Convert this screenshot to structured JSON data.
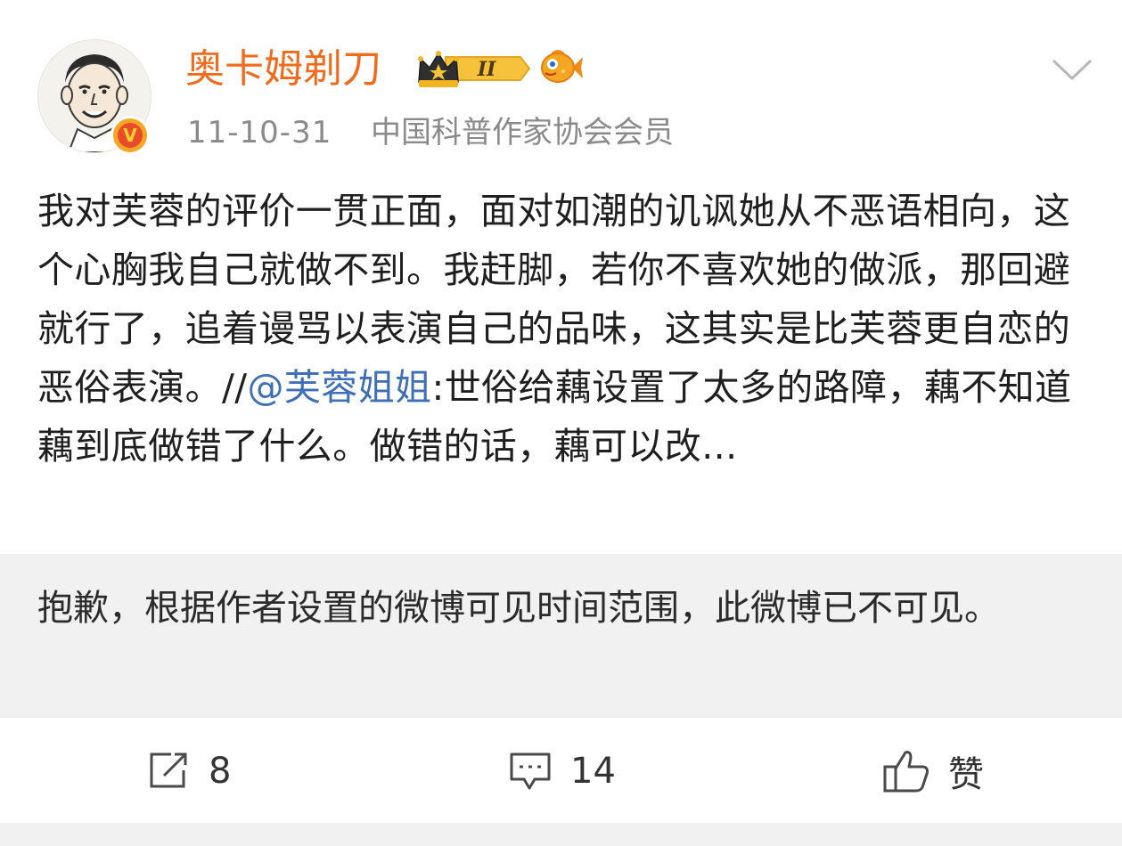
{
  "post": {
    "username": "奥卡姆剃刀",
    "time": "11-10-31",
    "user_description": "中国科普作家协会会员",
    "badges": {
      "crown_badge_text": "II",
      "verified_mark": "V"
    },
    "content_before_mention": "我对芙蓉的评价一贯正面，面对如潮的讥讽她从不恶语相向，这个心胸我自己就做不到。我赶脚，若你不喜欢她的做派，那回避就行了，追着谩骂以表演自己的品味，这其实是比芙蓉更自恋的恶俗表演。//",
    "mention": "@芙蓉姐姐",
    "content_after_mention": ":世俗给藕设置了太多的路障，藕不知道藕到底做错了什么。做错的话，藕可以改...",
    "retweet_unavailable_text": "抱歉，根据作者设置的微博可见时间范围，此微博已不可见。"
  },
  "actions": {
    "repost_count": "8",
    "comment_count": "14",
    "like_label": "赞"
  },
  "icons": {
    "more": "chevron-down-icon",
    "repost": "share-icon",
    "comment": "comment-icon",
    "like": "thumbs-up-icon",
    "verified": "verified-v-icon",
    "crown": "crown-badge-icon",
    "fish": "fish-badge-icon"
  },
  "colors": {
    "username": "#f26b1d",
    "mention": "#3f6fb6",
    "meta_text": "#8a8a8a",
    "retweet_bg": "#f1f1f1"
  }
}
